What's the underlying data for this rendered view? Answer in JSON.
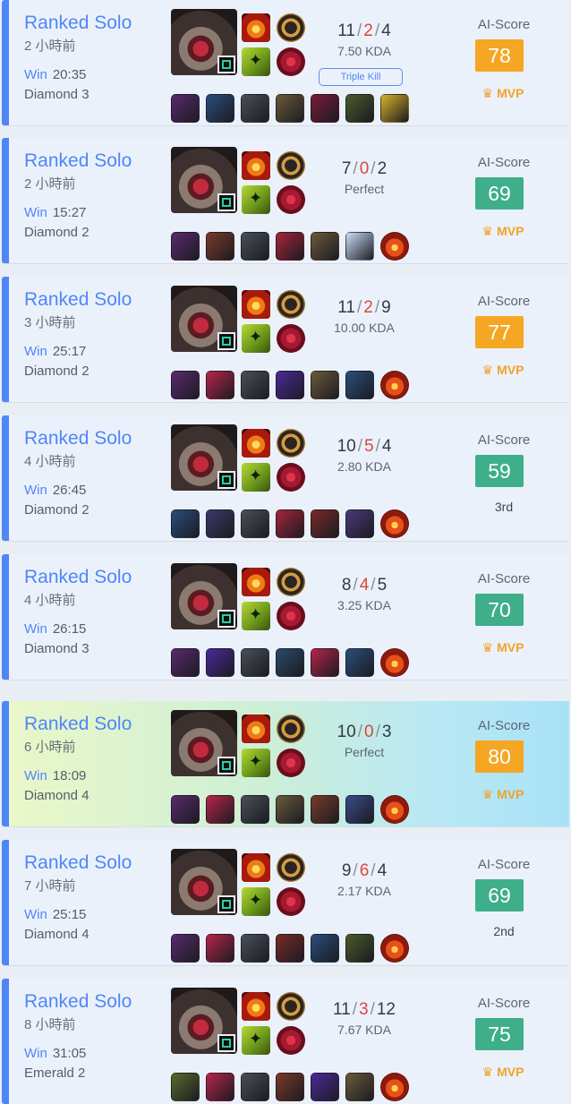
{
  "matches": [
    {
      "queue": "Ranked Solo",
      "ago": "2 小時前",
      "result": "Win",
      "duration": "20:35",
      "rank": "Diamond 3",
      "kills": "11",
      "deaths": "2",
      "assists": "4",
      "kda_text": "7.50 KDA",
      "badge": "Triple Kill",
      "ai_label": "AI-Score",
      "ai_score": "78",
      "ai_color": "#f5a623",
      "placement": "MVP",
      "is_mvp": true,
      "highlighted": false,
      "items": [
        "#5a2a6e",
        "#2a4e7c",
        "#4b4f57",
        "#6b5a3a",
        "#7a1a3a",
        "#4a5a2a",
        "#d9b22a"
      ]
    },
    {
      "queue": "Ranked Solo",
      "ago": "2 小時前",
      "result": "Win",
      "duration": "15:27",
      "rank": "Diamond 2",
      "kills": "7",
      "deaths": "0",
      "assists": "2",
      "kda_text": "Perfect",
      "badge": "",
      "ai_label": "AI-Score",
      "ai_score": "69",
      "ai_color": "#3fae8a",
      "placement": "MVP",
      "is_mvp": true,
      "highlighted": false,
      "items": [
        "#5a2a6e",
        "#7a3a28",
        "#4b4f57",
        "#a8243a",
        "#6b5a3a",
        "#c9dcf6",
        "t0"
      ]
    },
    {
      "queue": "Ranked Solo",
      "ago": "3 小時前",
      "result": "Win",
      "duration": "25:17",
      "rank": "Diamond 2",
      "kills": "11",
      "deaths": "2",
      "assists": "9",
      "kda_text": "10.00 KDA",
      "badge": "",
      "ai_label": "AI-Score",
      "ai_score": "77",
      "ai_color": "#f5a623",
      "placement": "MVP",
      "is_mvp": true,
      "highlighted": false,
      "items": [
        "#5a2a6e",
        "#b8244a",
        "#4b4f57",
        "#4a2a9a",
        "#6b5a3a",
        "#2a4e7c",
        "t0"
      ]
    },
    {
      "queue": "Ranked Solo",
      "ago": "4 小時前",
      "result": "Win",
      "duration": "26:45",
      "rank": "Diamond 2",
      "kills": "10",
      "deaths": "5",
      "assists": "4",
      "kda_text": "2.80 KDA",
      "badge": "",
      "ai_label": "AI-Score",
      "ai_score": "59",
      "ai_color": "#3fae8a",
      "placement": "3rd",
      "is_mvp": false,
      "highlighted": false,
      "items": [
        "#2a4e7c",
        "#3a3a6a",
        "#4b4f57",
        "#a8243a",
        "#7a2a2a",
        "#4a3a7a",
        "t0"
      ]
    },
    {
      "queue": "Ranked Solo",
      "ago": "4 小時前",
      "result": "Win",
      "duration": "26:15",
      "rank": "Diamond 3",
      "kills": "8",
      "deaths": "4",
      "assists": "5",
      "kda_text": "3.25 KDA",
      "badge": "",
      "ai_label": "AI-Score",
      "ai_score": "70",
      "ai_color": "#3fae8a",
      "placement": "MVP",
      "is_mvp": true,
      "highlighted": false,
      "items": [
        "#5a2a6e",
        "#4a2a9a",
        "#4b4f57",
        "#2a4a6a",
        "#b8244a",
        "#2a4e7c",
        "t0"
      ]
    },
    {
      "queue": "Ranked Solo",
      "ago": "6 小時前",
      "result": "Win",
      "duration": "18:09",
      "rank": "Diamond 4",
      "kills": "10",
      "deaths": "0",
      "assists": "3",
      "kda_text": "Perfect",
      "badge": "",
      "ai_label": "AI-Score",
      "ai_score": "80",
      "ai_color": "#f5a623",
      "placement": "MVP",
      "is_mvp": true,
      "highlighted": true,
      "items": [
        "#5a2a6e",
        "#b8244a",
        "#4b4f57",
        "#6b5a3a",
        "#7a3a28",
        "#3a4a8a",
        "t0"
      ]
    },
    {
      "queue": "Ranked Solo",
      "ago": "7 小時前",
      "result": "Win",
      "duration": "25:15",
      "rank": "Diamond 4",
      "kills": "9",
      "deaths": "6",
      "assists": "4",
      "kda_text": "2.17 KDA",
      "badge": "",
      "ai_label": "AI-Score",
      "ai_score": "69",
      "ai_color": "#3fae8a",
      "placement": "2nd",
      "is_mvp": false,
      "highlighted": false,
      "items": [
        "#5a2a6e",
        "#b8244a",
        "#4b4f57",
        "#7a2a2a",
        "#2a4e7c",
        "#4a5a2a",
        "t0"
      ]
    },
    {
      "queue": "Ranked Solo",
      "ago": "8 小時前",
      "result": "Win",
      "duration": "31:05",
      "rank": "Emerald 2",
      "kills": "11",
      "deaths": "3",
      "assists": "12",
      "kda_text": "7.67 KDA",
      "badge": "",
      "ai_label": "AI-Score",
      "ai_score": "75",
      "ai_color": "#3fae8a",
      "placement": "MVP",
      "is_mvp": true,
      "highlighted": false,
      "items": [
        "#5a6a2a",
        "#b8244a",
        "#4b4f57",
        "#7a3a28",
        "#4a2a9a",
        "#6b5a3a",
        "t0"
      ]
    }
  ]
}
